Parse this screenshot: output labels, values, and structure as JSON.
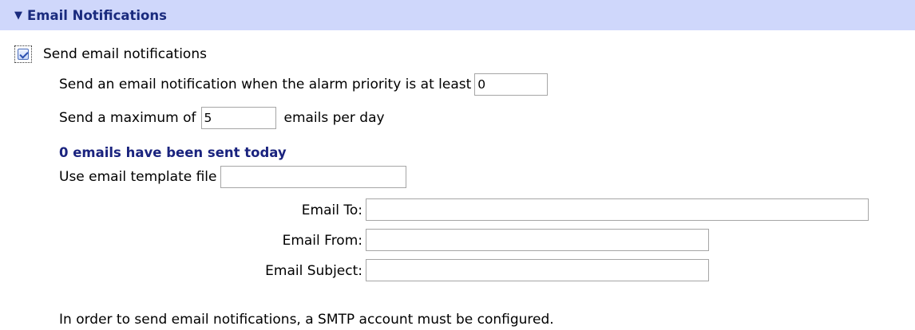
{
  "section": {
    "title": "Email Notifications",
    "collapse_icon": "triangle-down-icon"
  },
  "send_notifications": {
    "label": "Send email notifications",
    "checked": true
  },
  "priority": {
    "label": "Send an email notification when the alarm priority is at least",
    "value": "0"
  },
  "maximum": {
    "label_before": "Send a maximum of",
    "value": "5",
    "label_after": "emails per day"
  },
  "sent_status": "0 emails have been sent today",
  "template": {
    "label": "Use email template file",
    "value": ""
  },
  "email_to": {
    "label": "Email To:",
    "value": ""
  },
  "email_from": {
    "label": "Email From:",
    "value": ""
  },
  "email_subject": {
    "label": "Email Subject:",
    "value": ""
  },
  "footer_note": "In order to send email notifications, a SMTP account must be configured."
}
